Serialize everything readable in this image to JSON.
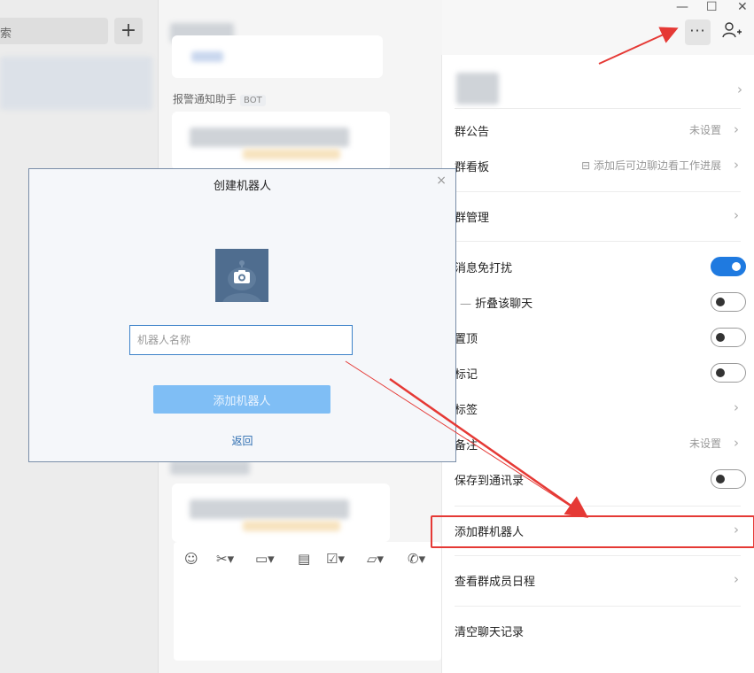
{
  "sidebar": {
    "search_text": "索",
    "add_label": "+"
  },
  "chat": {
    "bot_label": "报警通知助手",
    "bot_badge": "BOT"
  },
  "topbar": {
    "minimize": "—",
    "maximize": "☐",
    "close": "✕",
    "more_label": "···",
    "add_member_icon": "add-user-icon"
  },
  "panel": {
    "announcement": {
      "label": "群公告",
      "value": "未设置"
    },
    "board": {
      "label": "群看板",
      "value": "添加后可边聊边看工作进展"
    },
    "manage": {
      "label": "群管理"
    },
    "mute": {
      "label": "消息免打扰",
      "on": true
    },
    "fold": {
      "label": "折叠该聊天",
      "on": false
    },
    "pin": {
      "label": "置顶",
      "on": false
    },
    "mark": {
      "label": "标记",
      "on": false
    },
    "tags": {
      "label": "标签"
    },
    "remark": {
      "label": "备注",
      "value": "未设置"
    },
    "save_contacts": {
      "label": "保存到通讯录",
      "on": false
    },
    "add_bot": {
      "label": "添加群机器人"
    },
    "schedule": {
      "label": "查看群成员日程"
    },
    "clear": {
      "label": "清空聊天记录"
    }
  },
  "dialog": {
    "title": "创建机器人",
    "close": "×",
    "name_placeholder": "机器人名称",
    "add_button": "添加机器人",
    "back_link": "返回"
  },
  "colors": {
    "accent": "#1f7ae0",
    "highlight": "#e53935",
    "button_disabled": "#7fbef5"
  }
}
